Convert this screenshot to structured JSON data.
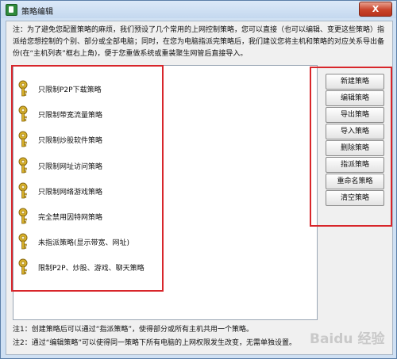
{
  "window": {
    "title": "策略编辑",
    "close_label": "X",
    "title_icon": "app-icon"
  },
  "intro_text": "注：为了避免您配置策略的麻烦，我们预设了几个常用的上网控制策略，您可以直接（也可以编辑、变更这些策略）指派给您想控制的个别、部分或全部电脑；同时，在您为电脑指派完策略后，我们建议您将主机和策略的对应关系导出备份(在“主机列表”框右上角)，便于您重做系统或重装聚生网管后直接导入。",
  "policies": [
    {
      "label": "只限制P2P下载策略",
      "icon": "key-icon"
    },
    {
      "label": "只限制带宽流量策略",
      "icon": "key-icon"
    },
    {
      "label": "只限制炒股软件策略",
      "icon": "key-icon"
    },
    {
      "label": "只限制网址访问策略",
      "icon": "key-icon"
    },
    {
      "label": "只限制网络游戏策略",
      "icon": "key-icon"
    },
    {
      "label": "完全禁用因特网策略",
      "icon": "key-icon"
    },
    {
      "label": "未指派策略(显示带宽、网址)",
      "icon": "key-icon"
    },
    {
      "label": "限制P2P、炒股、游戏、聊天策略",
      "icon": "key-icon"
    }
  ],
  "buttons": {
    "new": "新建策略",
    "edit": "编辑策略",
    "export": "导出策略",
    "import": "导入策略",
    "delete": "删除策略",
    "assign": "指派策略",
    "rename": "重命名策略",
    "clear": "清空策略"
  },
  "notes": {
    "note1": "注1：创建策略后可以通过“指派策略”，使得部分或所有主机共用一个策略。",
    "note2": "注2：通过“编辑策略”可以使得同一策略下所有电脑的上网权限发生改变，无需单独设置。"
  },
  "watermark": "Baidu 经验",
  "colors": {
    "highlight": "#d8262b",
    "titlebar": "#c4d8ef",
    "key_gold": "#d9b22a"
  }
}
